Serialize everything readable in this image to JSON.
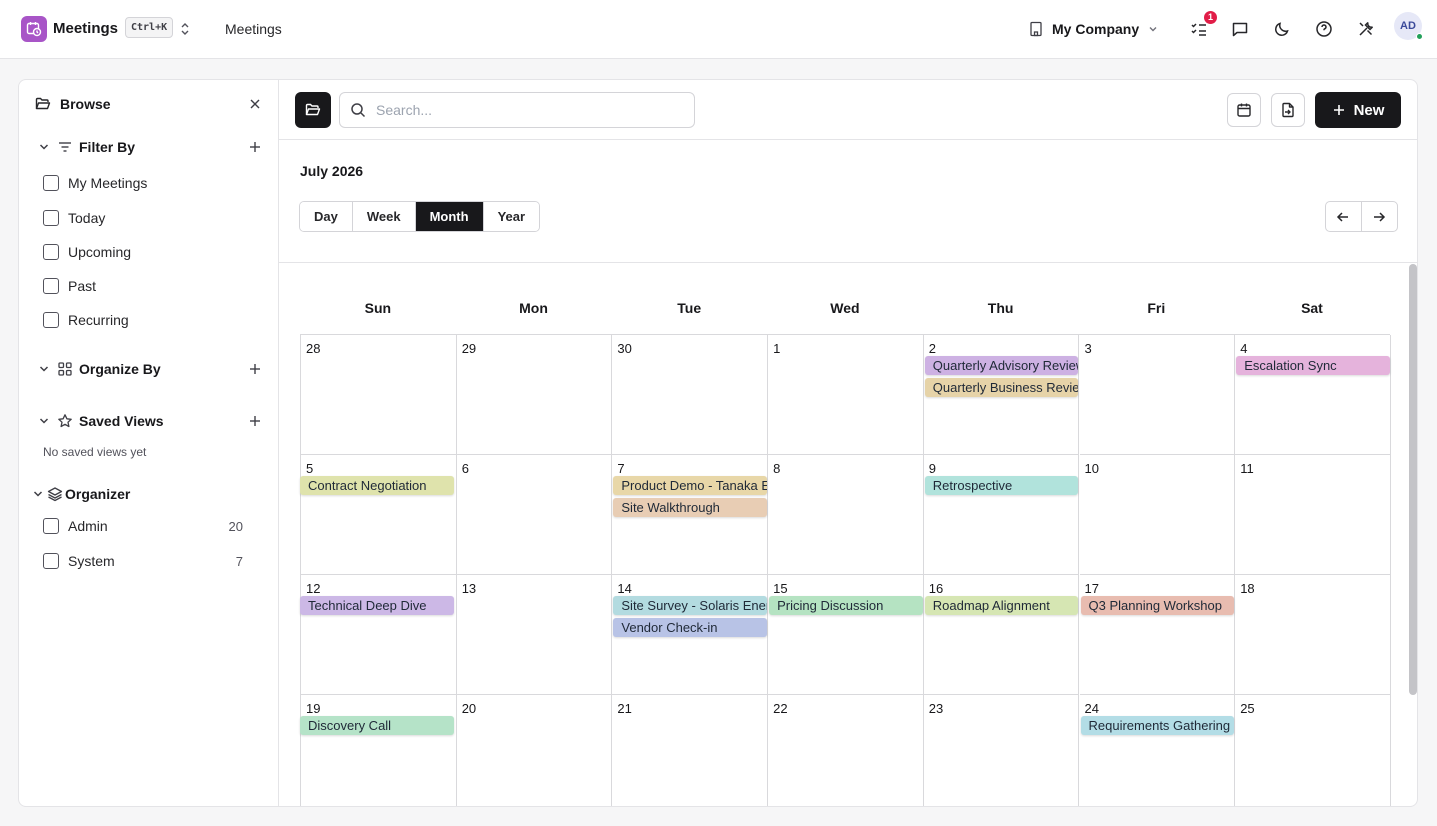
{
  "app": {
    "name": "Meetings",
    "shortcut": "Ctrl+K",
    "breadcrumb": "Meetings"
  },
  "header": {
    "company": "My Company",
    "notifications_count": "1",
    "avatar_initials": "AD"
  },
  "sidebar": {
    "title": "Browse",
    "filter_by": {
      "title": "Filter By",
      "items": [
        "My Meetings",
        "Today",
        "Upcoming",
        "Past",
        "Recurring"
      ]
    },
    "organize_by": {
      "title": "Organize By"
    },
    "saved_views": {
      "title": "Saved Views",
      "empty_text": "No saved views yet"
    },
    "organizer": {
      "title": "Organizer",
      "items": [
        {
          "label": "Admin",
          "count": "20"
        },
        {
          "label": "System",
          "count": "7"
        }
      ]
    }
  },
  "toolbar": {
    "search_placeholder": "Search...",
    "new_label": "New"
  },
  "calendar": {
    "month_title": "July 2026",
    "views": [
      "Day",
      "Week",
      "Month",
      "Year"
    ],
    "active_view": "Month",
    "weekdays": [
      "Sun",
      "Mon",
      "Tue",
      "Wed",
      "Thu",
      "Fri",
      "Sat"
    ],
    "weeks": [
      [
        "28",
        "29",
        "30",
        "1",
        "2",
        "3",
        "4"
      ],
      [
        "5",
        "6",
        "7",
        "8",
        "9",
        "10",
        "11"
      ],
      [
        "12",
        "13",
        "14",
        "15",
        "16",
        "17",
        "18"
      ],
      [
        "19",
        "20",
        "21",
        "22",
        "23",
        "24",
        "25"
      ]
    ],
    "events": [
      {
        "title": "Quarterly Advisory Review",
        "week": 0,
        "day": 4,
        "slot": 0,
        "color": "#cdb1e3"
      },
      {
        "title": "Quarterly Business Review",
        "week": 0,
        "day": 4,
        "slot": 1,
        "color": "#e6d3a8"
      },
      {
        "title": "Escalation Sync",
        "week": 0,
        "day": 6,
        "slot": 0,
        "color": "#e5b3dc"
      },
      {
        "title": "Contract Negotiation",
        "week": 1,
        "day": 0,
        "slot": 0,
        "color": "#dfe3ac"
      },
      {
        "title": "Product Demo - Tanaka Electronics",
        "week": 1,
        "day": 2,
        "slot": 0,
        "color": "#e8d7a8"
      },
      {
        "title": "Site Walkthrough",
        "week": 1,
        "day": 2,
        "slot": 1,
        "color": "#e8cdb4"
      },
      {
        "title": "Retrospective",
        "week": 1,
        "day": 4,
        "slot": 0,
        "color": "#b1e3dc"
      },
      {
        "title": "Technical Deep Dive",
        "week": 2,
        "day": 0,
        "slot": 0,
        "color": "#ccb8e6"
      },
      {
        "title": "Site Survey - Solaris Energy",
        "week": 2,
        "day": 2,
        "slot": 0,
        "color": "#b3dbe0"
      },
      {
        "title": "Vendor Check-in",
        "week": 2,
        "day": 2,
        "slot": 1,
        "color": "#b8c3e6"
      },
      {
        "title": "Pricing Discussion",
        "week": 2,
        "day": 3,
        "slot": 0,
        "color": "#b5e3c2"
      },
      {
        "title": "Roadmap Alignment",
        "week": 2,
        "day": 4,
        "slot": 0,
        "color": "#d6e6b3"
      },
      {
        "title": "Q3 Planning Workshop",
        "week": 2,
        "day": 5,
        "slot": 0,
        "color": "#e8bcb0"
      },
      {
        "title": "Discovery Call",
        "week": 3,
        "day": 0,
        "slot": 0,
        "color": "#b5e3c8"
      },
      {
        "title": "Requirements Gathering",
        "week": 3,
        "day": 5,
        "slot": 0,
        "color": "#b3dde6"
      }
    ]
  },
  "icons": {
    "app": "calendar-clock-icon",
    "switch": "chevrons-up-down-icon",
    "company": "building-icon",
    "tasks": "list-checks-icon",
    "chat": "message-square-icon",
    "theme": "moon-icon",
    "help": "help-circle-icon",
    "tools": "tools-icon",
    "folder": "folder-open-icon",
    "search": "search-icon",
    "calendar": "calendar-icon",
    "export": "file-export-icon"
  },
  "colors": {
    "accent": "#a855c7",
    "primary": "#18181b",
    "badge": "#e11d48",
    "online": "#22a05a"
  }
}
